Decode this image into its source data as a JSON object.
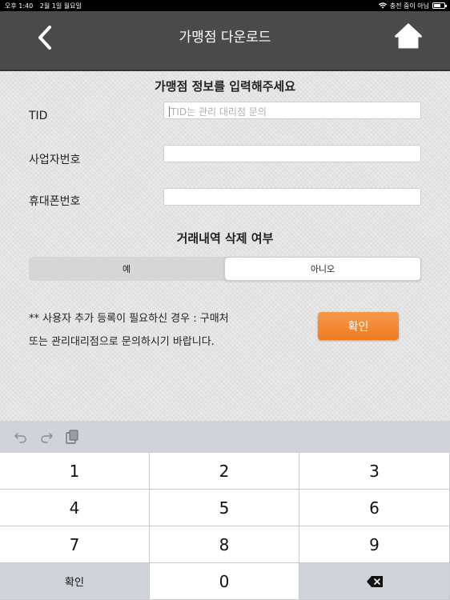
{
  "status_bar": {
    "time": "오후 1:40",
    "date": "2월 1일 월요일",
    "charging_text": "충전 중이 아님",
    "battery_level": 0.7
  },
  "nav": {
    "title": "가맹점 다운로드",
    "back_icon": "chevron-left-icon",
    "home_icon": "home-icon"
  },
  "form": {
    "section_title": "가맹점 정보를 입력해주세요",
    "tid_label": "TID",
    "tid_placeholder": "TID는 관리 대리점 문의",
    "tid_value": "",
    "biz_label": "사업자번호",
    "biz_value": "",
    "phone_label": "휴대폰번호",
    "phone_value": ""
  },
  "delete_history": {
    "title": "거래내역 삭제 여부",
    "options": [
      "예",
      "아니오"
    ],
    "selected": "아니오"
  },
  "notice": {
    "line1": "** 사용자 추가 등록이 필요하신 경우 : 구매처",
    "line2": "또는 관리대리점으로 문의하시기 바랍니다."
  },
  "confirm_label": "확인",
  "keyboard": {
    "tools": [
      "undo-icon",
      "redo-icon",
      "paste-icon"
    ],
    "keys": [
      "1",
      "2",
      "3",
      "4",
      "5",
      "6",
      "7",
      "8",
      "9",
      "확인",
      "0",
      "delete-icon"
    ]
  },
  "colors": {
    "navbar": "#4a4a4a",
    "accent": "#f08a30",
    "background": "#e4e4e4"
  }
}
